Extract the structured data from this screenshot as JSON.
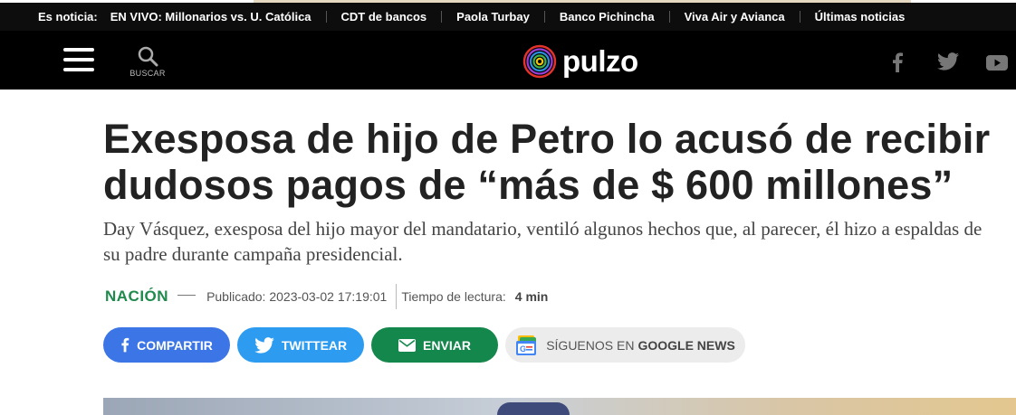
{
  "ticker": {
    "lead": "Es noticia:",
    "items": [
      "EN VIVO: Millonarios vs. U. Católica",
      "CDT de bancos",
      "Paola Turbay",
      "Banco Pichincha",
      "Viva Air y Avianca",
      "Últimas noticias"
    ]
  },
  "header": {
    "search_label": "BUSCAR",
    "logo_text": "pulzo",
    "social": [
      "facebook-icon",
      "twitter-icon",
      "youtube-icon"
    ]
  },
  "article": {
    "title": "Exesposa de hijo de Petro lo acusó de recibir dudosos pagos de “más de $ 600 millones”",
    "lede": "Day Vásquez, exesposa del hijo mayor del mandatario, ventiló algunos hechos que, al parecer, él hizo a espaldas de su padre durante campaña presidencial.",
    "section": "NACIÓN",
    "published": "Publicado: 2023-03-02 17:19:01",
    "read_time_label": "Tiempo de lectura:",
    "read_time_value": "4 min"
  },
  "share": {
    "facebook": "COMPARTIR",
    "twitter": "TWITTEAR",
    "email": "ENVIAR",
    "google_prefix": "SÍGUENOS EN",
    "google_bold": "GOOGLE NEWS"
  },
  "colors": {
    "section_green": "#1f8a4c",
    "facebook_blue": "#3b75e6",
    "twitter_blue": "#2d9cf0",
    "email_green": "#14874c"
  }
}
